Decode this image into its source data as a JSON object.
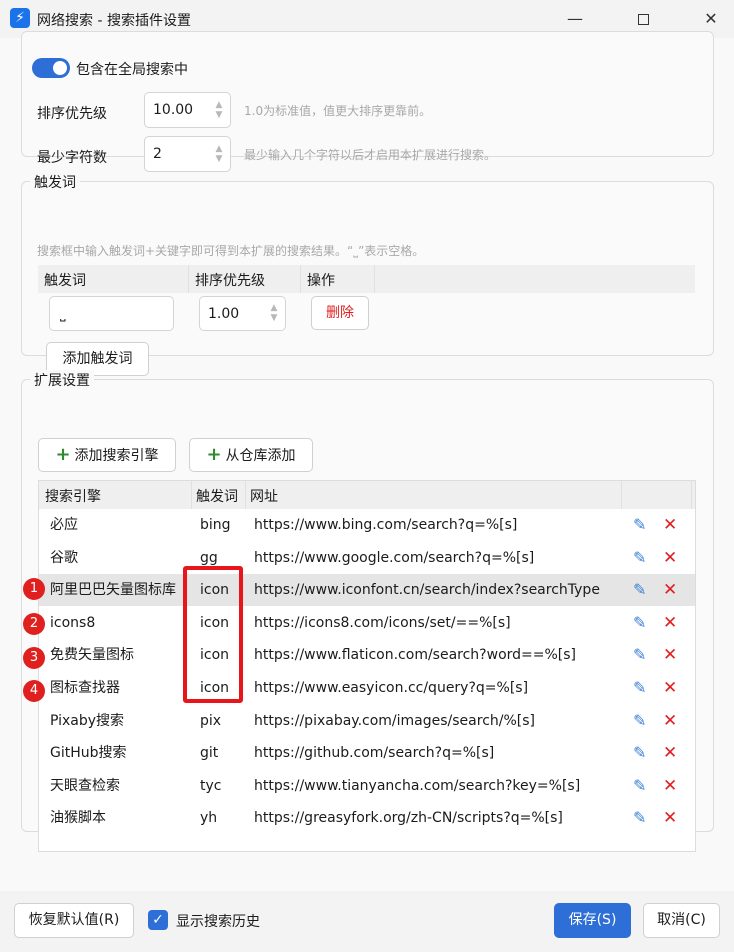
{
  "window": {
    "title": "网络搜索 - 搜索插件设置",
    "app_icon": "lightning-bolt",
    "minimize": "—",
    "close": "✕"
  },
  "general": {
    "include_global_label": "包含在全局搜索中",
    "include_global_on": true,
    "priority_label": "排序优先级",
    "priority_value": "10.00",
    "priority_hint": "1.0为标准值，值更大排序更靠前。",
    "min_chars_label": "最少字符数",
    "min_chars_value": "2",
    "min_chars_hint": "最少输入几个字符以后才启用本扩展进行搜索。"
  },
  "triggers": {
    "legend": "触发词",
    "hint": "搜索框中输入触发词+关键字即可得到本扩展的搜索结果。“⎵”表示空格。",
    "col_trigger": "触发词",
    "col_priority": "排序优先级",
    "col_action": "操作",
    "row_trigger": "⎵",
    "row_priority": "1.00",
    "delete_label": "删除",
    "add_label": "添加触发词"
  },
  "extensions": {
    "legend": "扩展设置",
    "add_engine_label": "添加搜索引擎",
    "add_repo_label": "从仓库添加",
    "col_engine": "搜索引擎",
    "col_trigger": "触发词",
    "col_url": "网址",
    "rows": [
      {
        "name": "必应",
        "trigger": "bing",
        "url": "https://www.bing.com/search?q=%[s]"
      },
      {
        "name": "谷歌",
        "trigger": "gg",
        "url": "https://www.google.com/search?q=%[s]"
      },
      {
        "name": "阿里巴巴矢量图标库",
        "trigger": "icon",
        "url": "https://www.iconfont.cn/search/index?searchType"
      },
      {
        "name": "icons8",
        "trigger": "icon",
        "url": "https://icons8.com/icons/set/==%[s]"
      },
      {
        "name": "免费矢量图标",
        "trigger": "icon",
        "url": "https://www.flaticon.com/search?word==%[s]"
      },
      {
        "name": "图标查找器",
        "trigger": "icon",
        "url": "https://www.easyicon.cc/query?q=%[s]"
      },
      {
        "name": "Pixaby搜索",
        "trigger": "pix",
        "url": "https://pixabay.com/images/search/%[s]"
      },
      {
        "name": "GitHub搜索",
        "trigger": "git",
        "url": "https://github.com/search?q=%[s]"
      },
      {
        "name": "天眼查检索",
        "trigger": "tyc",
        "url": "https://www.tianyancha.com/search?key=%[s]"
      },
      {
        "name": "油猴脚本",
        "trigger": "yh",
        "url": "https://greasyfork.org/zh-CN/scripts?q=%[s]"
      }
    ],
    "badges": [
      "1",
      "2",
      "3",
      "4"
    ],
    "selected_row_index": 2
  },
  "footer": {
    "reset_label": "恢复默认值(R)",
    "show_history_label": "显示搜索历史",
    "show_history_checked": true,
    "save_label": "保存(S)",
    "cancel_label": "取消(C)"
  },
  "colors": {
    "accent": "#2d6fd6",
    "danger": "#e02020",
    "highlight": "#e8151a"
  }
}
